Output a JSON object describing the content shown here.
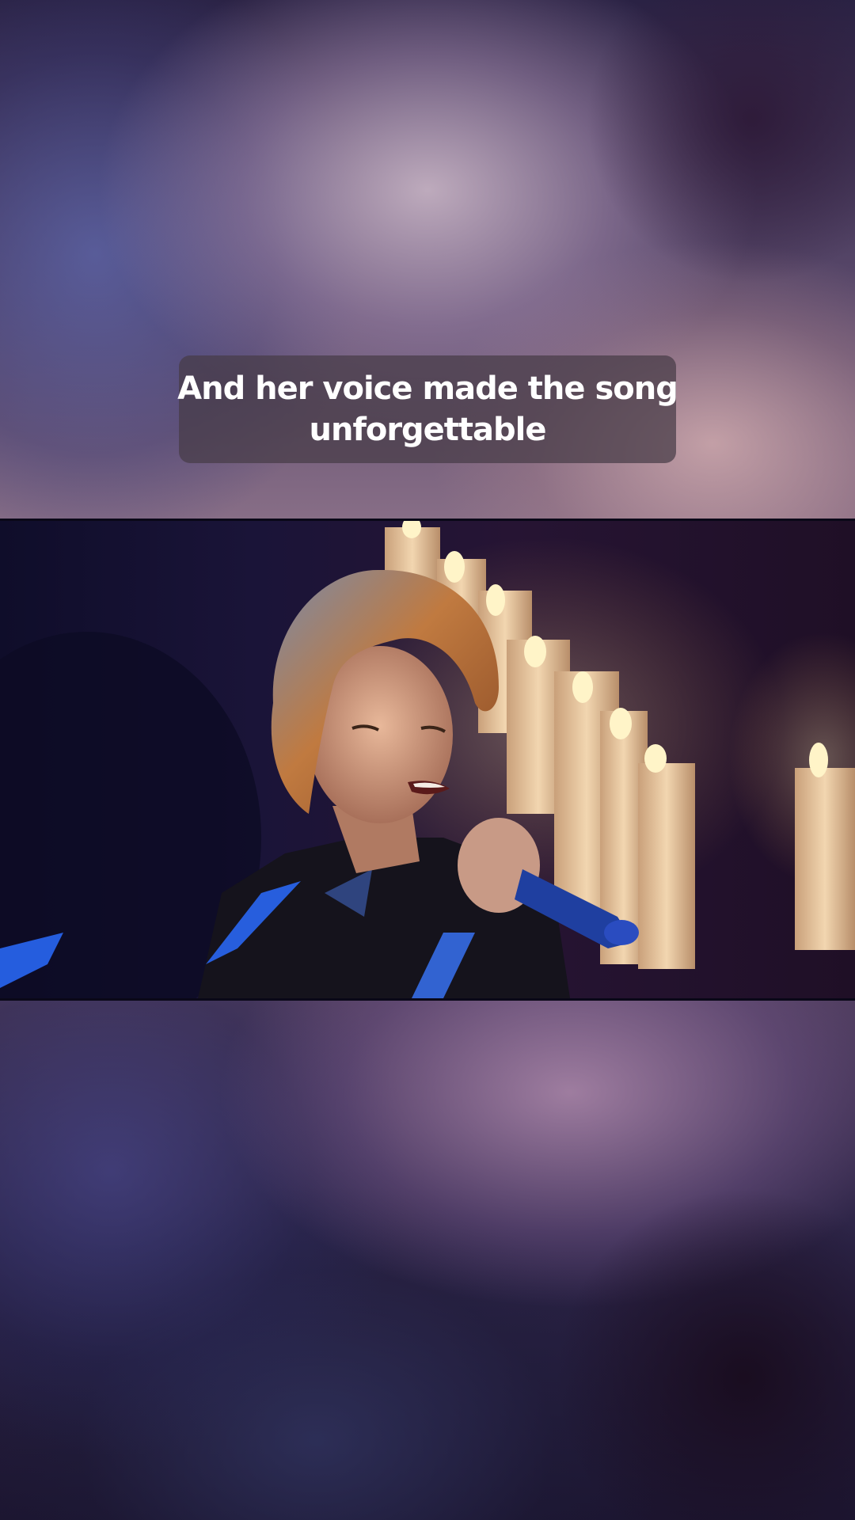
{
  "caption": {
    "line1": "And her voice made the song",
    "line2": "unforgettable"
  },
  "video": {
    "scene": "performer-singing-with-candles",
    "colors": {
      "stage_left": "#0f0d2a",
      "stage_right": "#261433",
      "candle_wax": "#e8c8a0",
      "flame": "#fff4c8",
      "jacket_highlight": "#2a6cff",
      "hair": "#b06a38"
    }
  }
}
